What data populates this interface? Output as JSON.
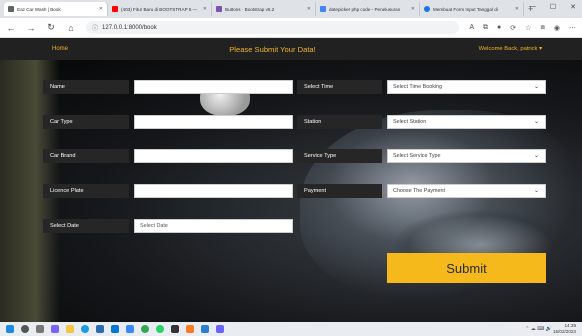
{
  "browser": {
    "tabs": [
      {
        "label": "Eaz Car Wash | Book",
        "icon": "page-icon",
        "color": "#5f6368",
        "active": true
      },
      {
        "label": "(403) Fitur Baru di BOOTSTRAP 5 —",
        "icon": "youtube-icon",
        "color": "#ff0000",
        "active": false
      },
      {
        "label": "Buttons · Bootstrap v5.2",
        "icon": "bootstrap-icon",
        "color": "#7952b3",
        "active": false
      },
      {
        "label": "datepicker php code - Penelusuran",
        "icon": "google-icon",
        "color": "#4285f4",
        "active": false
      },
      {
        "label": "Membuat Form Input Tanggal di",
        "icon": "globe-icon",
        "color": "#1a73e8",
        "active": false
      }
    ],
    "new_tab": "+",
    "url": "127.0.0.1:8000/book"
  },
  "navbar": {
    "home": "Home",
    "title": "Please Submit Your Data!",
    "user": "Welcome Back, patrick"
  },
  "form": {
    "name_label": "Name",
    "car_type_label": "Car Type",
    "car_brand_label": "Car Brand",
    "licence_plate_label": "Licence Plate",
    "select_date_label": "Select Date",
    "select_date_placeholder": "Select Date",
    "select_time_label": "Select Time",
    "select_time_value": "Select Time Booking",
    "station_label": "Station",
    "station_value": "Select Station",
    "service_type_label": "Service Type",
    "service_type_value": "Select Service Type",
    "payment_label": "Payment",
    "payment_value": "Choose The Payment",
    "submit_label": "Submit"
  },
  "taskbar": {
    "time": "14:39",
    "date": "15/02/2023"
  },
  "colors": {
    "accent": "#f5b91b",
    "navbar_bg": "#212121",
    "label_bg": "#262626"
  }
}
